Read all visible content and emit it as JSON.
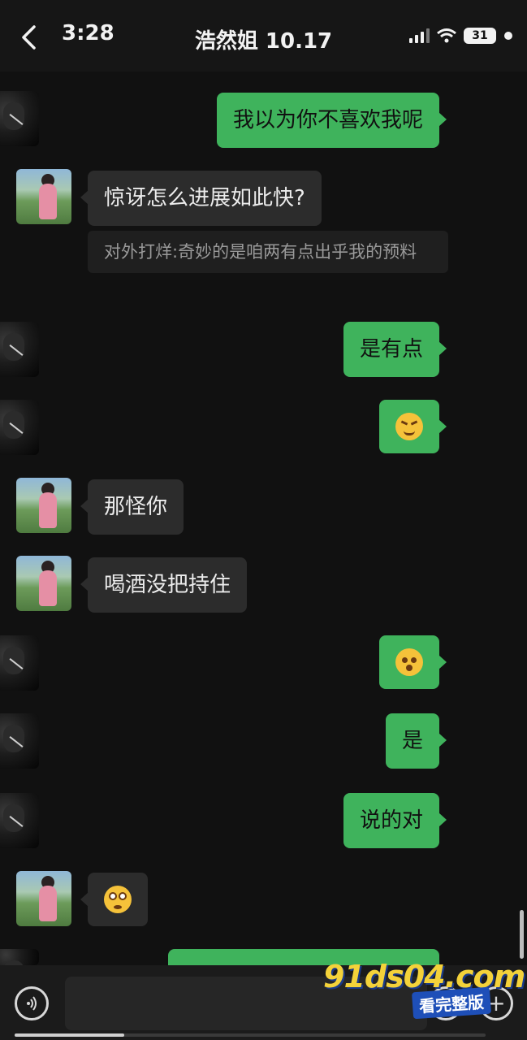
{
  "status_bar": {
    "time": "3:28",
    "battery": "31"
  },
  "header": {
    "title": "浩然姐 10.17"
  },
  "messages": [
    {
      "side": "right",
      "text": "我以为你不喜欢我呢"
    },
    {
      "side": "left",
      "text": "惊讶怎么进展如此快?",
      "quote": "对外打烊:奇妙的是咱两有点出乎我的预料"
    },
    {
      "side": "right",
      "text": "是有点"
    },
    {
      "side": "right",
      "emoji": "grinning-squint-emoji"
    },
    {
      "side": "left",
      "text": "那怪你"
    },
    {
      "side": "left",
      "text": "喝酒没把持住"
    },
    {
      "side": "right",
      "emoji": "drool-emoji"
    },
    {
      "side": "right",
      "text": "是"
    },
    {
      "side": "right",
      "text": "说的对"
    },
    {
      "side": "left",
      "emoji": "rolling-eyes-emoji"
    }
  ],
  "input_bar": {
    "voice_icon": "voice-icon",
    "emoji_icon": "emoji-icon",
    "plus_icon": "plus-icon"
  },
  "watermark": {
    "site": "91ds04.com",
    "sub": "看完整版"
  },
  "colors": {
    "sent_bubble": "#3fb35c",
    "received_bubble": "#2c2c2c",
    "background": "#111111"
  }
}
